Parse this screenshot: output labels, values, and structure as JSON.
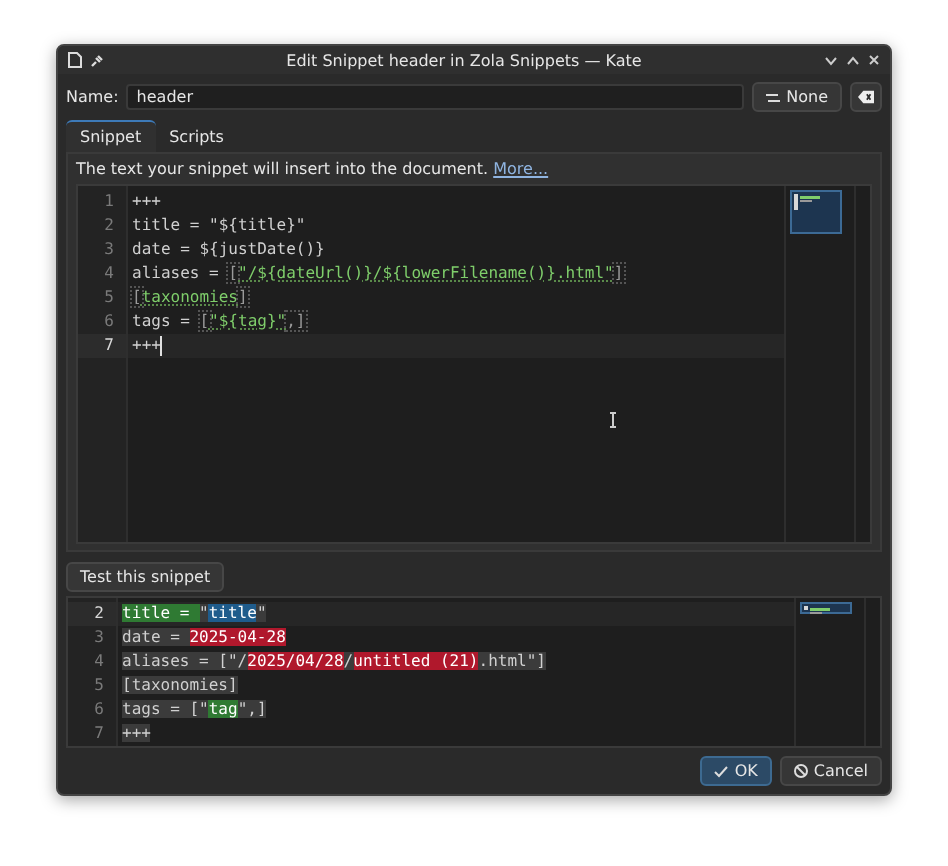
{
  "window": {
    "title": "Edit Snippet header in Zola Snippets — Kate"
  },
  "name_field": {
    "label": "Name:",
    "value": "header"
  },
  "shortcut_button": {
    "label": "None"
  },
  "tabs": [
    {
      "label": "Snippet",
      "selected": true
    },
    {
      "label": "Scripts",
      "selected": false
    }
  ],
  "hint": {
    "text": "The text your snippet will insert into the document.",
    "link": "More..."
  },
  "editor": {
    "lines": [
      {
        "number": "1",
        "current": false,
        "segments": [
          {
            "text": "+++",
            "kind": "plain"
          }
        ]
      },
      {
        "number": "2",
        "current": false,
        "segments": [
          {
            "text": "title = \"${title}\"",
            "kind": "plain"
          }
        ]
      },
      {
        "number": "3",
        "current": false,
        "segments": [
          {
            "text": "date = ${justDate()}",
            "kind": "plain"
          }
        ]
      },
      {
        "number": "4",
        "current": false,
        "segments": [
          {
            "text": "aliases = ",
            "kind": "plain"
          },
          {
            "text": "[",
            "kind": "bracket"
          },
          {
            "text": "\"/${dateUrl()}/${lowerFilename()}.html\"",
            "kind": "field"
          },
          {
            "text": "]",
            "kind": "bracket"
          }
        ]
      },
      {
        "number": "5",
        "current": false,
        "segments": [
          {
            "text": "[",
            "kind": "bracket"
          },
          {
            "text": "taxonomies",
            "kind": "field"
          },
          {
            "text": "]",
            "kind": "bracket"
          }
        ]
      },
      {
        "number": "6",
        "current": false,
        "segments": [
          {
            "text": "tags = ",
            "kind": "plain"
          },
          {
            "text": "[",
            "kind": "bracket"
          },
          {
            "text": "\"${tag}\"",
            "kind": "field"
          },
          {
            "text": ",]",
            "kind": "bracket"
          }
        ]
      },
      {
        "number": "7",
        "current": true,
        "segments": [
          {
            "text": "+++",
            "kind": "plain"
          }
        ]
      }
    ]
  },
  "test_button": {
    "label": "Test this snippet"
  },
  "preview": {
    "lines": [
      {
        "number": "2",
        "current": true,
        "segments": [
          {
            "text": "title = ",
            "kind": "green"
          },
          {
            "text": "\"",
            "kind": "gray"
          },
          {
            "text": "title",
            "kind": "blue"
          },
          {
            "text": "\"",
            "kind": "gray"
          }
        ]
      },
      {
        "number": "3",
        "current": false,
        "segments": [
          {
            "text": "date = ",
            "kind": "gray"
          },
          {
            "text": "2025-04-28",
            "kind": "red"
          }
        ]
      },
      {
        "number": "4",
        "current": false,
        "segments": [
          {
            "text": "aliases = [\"/",
            "kind": "gray"
          },
          {
            "text": "2025/04/28",
            "kind": "red"
          },
          {
            "text": "/",
            "kind": "gray"
          },
          {
            "text": "untitled (21)",
            "kind": "red"
          },
          {
            "text": ".html\"]",
            "kind": "gray"
          }
        ]
      },
      {
        "number": "5",
        "current": false,
        "segments": [
          {
            "text": "[taxonomies]",
            "kind": "gray"
          }
        ]
      },
      {
        "number": "6",
        "current": false,
        "segments": [
          {
            "text": "tags = [\"",
            "kind": "gray"
          },
          {
            "text": "tag",
            "kind": "green"
          },
          {
            "text": "\",]",
            "kind": "gray"
          }
        ]
      },
      {
        "number": "7",
        "current": false,
        "segments": [
          {
            "text": "+++",
            "kind": "gray"
          }
        ]
      }
    ]
  },
  "buttons": [
    {
      "label": "OK",
      "kind": "ok",
      "default": true
    },
    {
      "label": "Cancel",
      "kind": "cancel",
      "default": false
    }
  ]
}
